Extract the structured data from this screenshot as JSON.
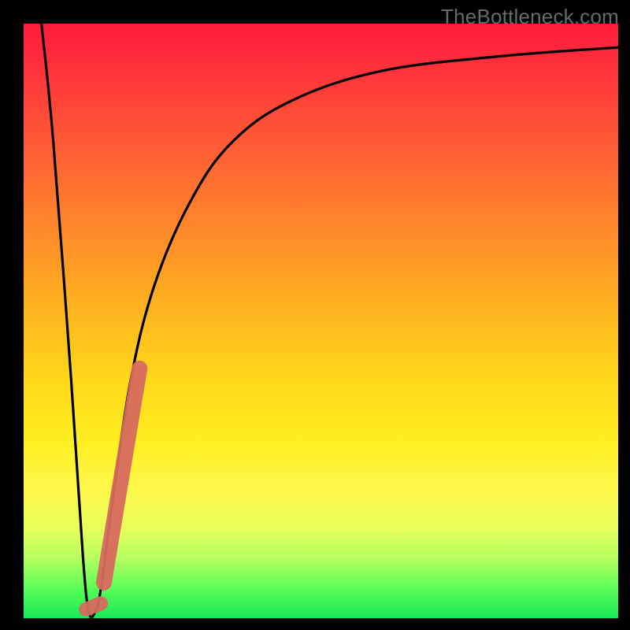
{
  "watermark": "TheBottleneck.com",
  "colors": {
    "page_bg": "#000000",
    "gradient_top": "#ff1a3c",
    "gradient_bottom": "#18e858",
    "curve": "#000000",
    "overlay": "#d66a5e",
    "watermark_text": "#6a6a6a"
  },
  "chart_data": {
    "type": "line",
    "title": "",
    "xlabel": "",
    "ylabel": "",
    "xlim": [
      0,
      100
    ],
    "ylim": [
      0,
      100
    ],
    "grid": false,
    "legend": false,
    "annotations": [
      "TheBottleneck.com"
    ],
    "series": [
      {
        "name": "bottleneck-curve",
        "x": [
          3,
          5,
          8,
          10,
          11,
          12,
          13,
          15,
          18,
          22,
          28,
          35,
          45,
          60,
          80,
          100
        ],
        "y": [
          100,
          80,
          40,
          10,
          1,
          1,
          5,
          20,
          40,
          56,
          70,
          80,
          87,
          92,
          94.5,
          96
        ]
      },
      {
        "name": "highlight-segment",
        "x": [
          13.5,
          19.5
        ],
        "y": [
          6,
          42
        ]
      },
      {
        "name": "highlight-flat",
        "x": [
          10.5,
          13
        ],
        "y": [
          1.5,
          2.5
        ]
      }
    ]
  }
}
